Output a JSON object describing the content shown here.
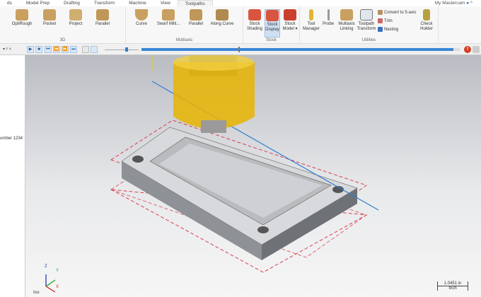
{
  "tabs": [
    "ds",
    "Model Prep",
    "Drafting",
    "Transform",
    "Machine",
    "View",
    "Toolpaths"
  ],
  "active_tab": "Toolpaths",
  "account": "My Mastercam",
  "groups": {
    "g3d": {
      "label": "3D",
      "buttons": [
        "OptiRough",
        "Pocket",
        "Project",
        "Parallel"
      ]
    },
    "multiaxis": {
      "label": "Multiaxis",
      "buttons": [
        "Curve",
        "Swarf Milli...",
        "Parallel",
        "Along Curve"
      ]
    },
    "stock": {
      "label": "Stock",
      "buttons": [
        "Stock Shading",
        "Stock Display",
        "Stock Model ▾"
      ]
    },
    "utilities": {
      "label": "Utilities",
      "buttons": [
        "Tool Manager",
        "Probe",
        "Multiaxis Linking",
        "Toolpath Transform",
        "Check Holder"
      ],
      "small": [
        "Convert to 5-axis",
        "Trim",
        "Nesting"
      ]
    }
  },
  "toolbar": {
    "pin": "▾ ᵖ ×",
    "playback": [
      "▶",
      "■",
      "⏮",
      "⏪",
      "⏩",
      "⏭"
    ],
    "progress_percent": 98,
    "speed_slider_percent": 60
  },
  "left_panel": {
    "text": "umber 1234"
  },
  "viewport": {
    "view_name": "Iso",
    "scale": "1.0451 in",
    "units": "Inch",
    "axes": [
      "Z",
      "Y",
      "X"
    ]
  },
  "colors": {
    "accent": "#2f7fd0",
    "tool": "#e8b400",
    "stock_box": "#d9404f"
  }
}
